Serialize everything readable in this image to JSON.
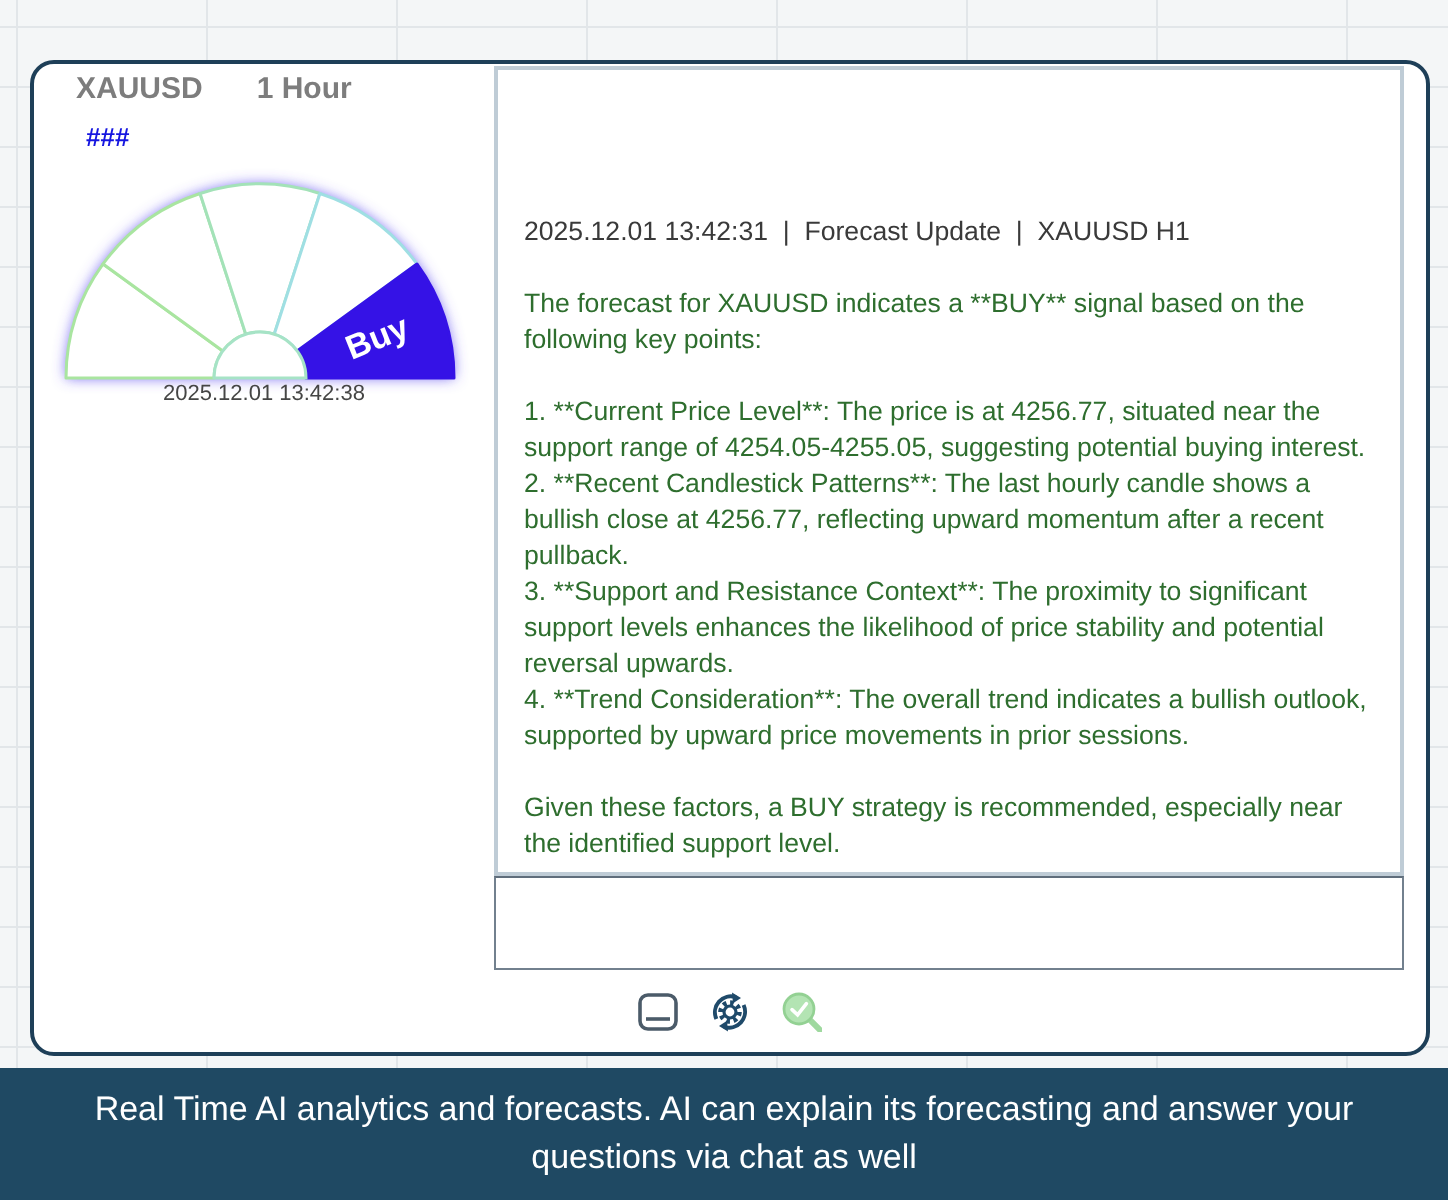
{
  "header": {
    "symbol": "XAUUSD",
    "timeframe": "1 Hour",
    "indicator": "###"
  },
  "gauge": {
    "segments": [
      {
        "selected": false
      },
      {
        "selected": false
      },
      {
        "selected": false
      },
      {
        "selected": false
      },
      {
        "selected": true
      }
    ],
    "signal": "Buy",
    "timestamp": "2025.12.01 13:42:38"
  },
  "message": {
    "header": "2025.12.01 13:42:31  |  Forecast Update  |  XAUUSD H1",
    "intro": "The forecast for XAUUSD indicates a **BUY** signal based on the following key points:",
    "points": [
      "1. **Current Price Level**: The price is at 4256.77, situated near the support range of 4254.05-4255.05, suggesting potential buying interest.",
      "2. **Recent Candlestick Patterns**: The last hourly candle shows a bullish close at 4256.77, reflecting upward momentum after a recent pullback.",
      "3. **Support and Resistance Context**: The proximity to significant support levels enhances the likelihood of price stability and potential reversal upwards.",
      "4. **Trend Consideration**: The overall trend indicates a bullish outlook, supported by upward price movements in prior sessions."
    ],
    "conclusion": "Given these factors, a BUY strategy is recommended, especially near the identified support level."
  },
  "caption": "Real Time AI analytics and forecasts. AI can explain its forecasting and answer your questions via chat as well"
}
